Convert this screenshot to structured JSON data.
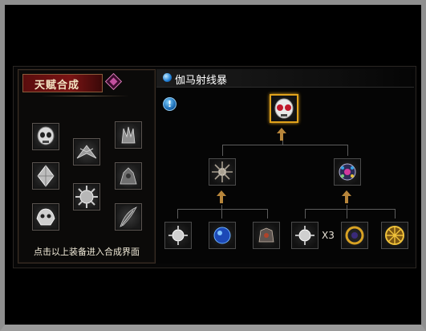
{
  "talent_panel": {
    "title": "天赋合成",
    "caption": "点击以上装备进入合成界面",
    "items": [
      {
        "icon": "skull-helmet-icon"
      },
      {
        "icon": "winged-blade-icon"
      },
      {
        "icon": "claw-gauntlet-icon"
      },
      {
        "icon": "crystal-shard-icon"
      },
      {
        "icon": "spiked-orb-icon"
      },
      {
        "icon": "armored-beast-icon"
      },
      {
        "icon": "beast-skull-icon"
      },
      {
        "icon": "dark-feather-icon"
      }
    ]
  },
  "recipe_panel": {
    "item_name": "伽马射线暴",
    "quantity_label": "X3",
    "colors": {
      "accent_gold": "#e0a21c",
      "title_red": "#7a1414",
      "orb_blue": "#1f7fd6"
    }
  }
}
